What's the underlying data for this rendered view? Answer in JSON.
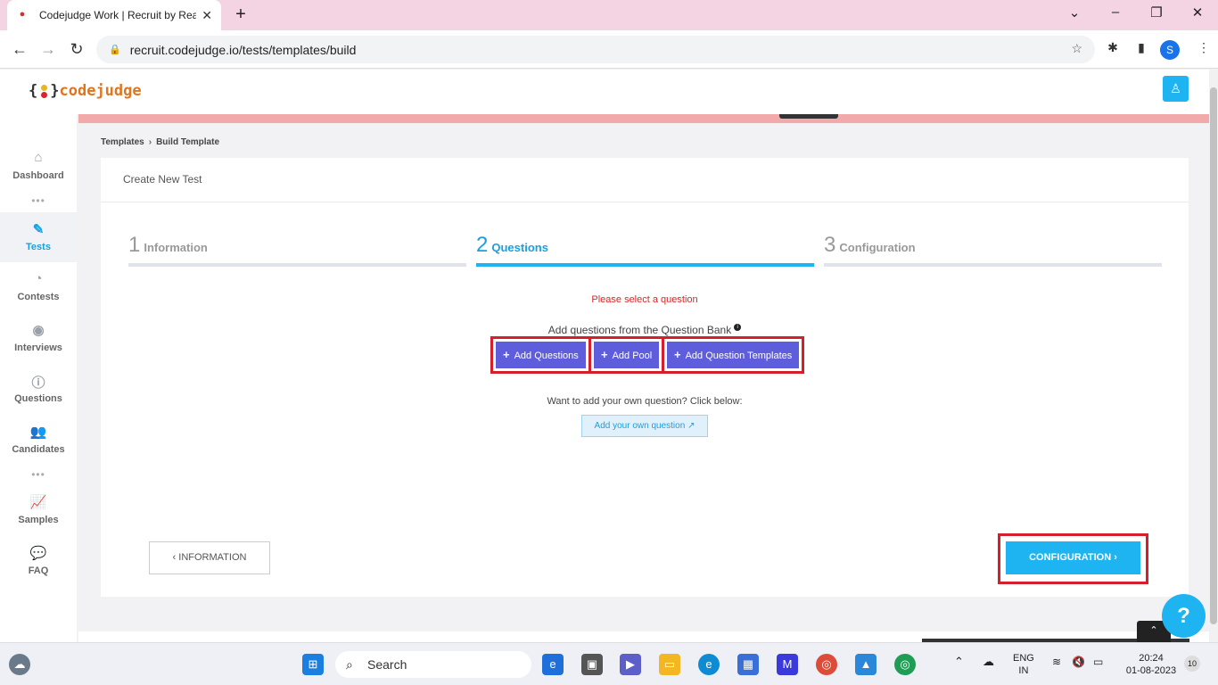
{
  "browser": {
    "tab_title": "Codejudge Work | Recruit by Rea",
    "tab_close": "✕",
    "new_tab": "+",
    "url": "recruit.codejudge.io/tests/templates/build",
    "profile_initial": "S"
  },
  "logo": {
    "text": "codejudge"
  },
  "sidebar": {
    "items": [
      {
        "label": "Dashboard",
        "icon": "home-icon"
      },
      {
        "label": "Tests",
        "icon": "pen-icon"
      },
      {
        "label": "Contests",
        "icon": "pie-chart-icon"
      },
      {
        "label": "Interviews",
        "icon": "podcast-icon"
      },
      {
        "label": "Questions",
        "icon": "question-circle-icon"
      },
      {
        "label": "Candidates",
        "icon": "users-icon"
      },
      {
        "label": "Samples",
        "icon": "chart-line-icon"
      },
      {
        "label": "FAQ",
        "icon": "comments-icon"
      }
    ]
  },
  "breadcrumb": {
    "root": "Templates",
    "sep": "›",
    "current": "Build Template"
  },
  "card": {
    "title": "Create New Test"
  },
  "steps": [
    {
      "num": "1",
      "label": "Information"
    },
    {
      "num": "2",
      "label": "Questions"
    },
    {
      "num": "3",
      "label": "Configuration"
    }
  ],
  "messages": {
    "error": "Please select a question",
    "question_bank": "Add questions from the Question Bank",
    "own_question": "Want to add your own question? Click below:"
  },
  "buttons": {
    "add_questions": "Add Questions",
    "add_pool": "Add Pool",
    "add_templates": "Add Question Templates",
    "add_own": "Add your own question",
    "back": "‹ INFORMATION",
    "next": "CONFIGURATION ›",
    "help": "?"
  },
  "taskbar": {
    "search": "Search",
    "lang_top": "ENG",
    "lang_bottom": "IN",
    "time": "20:24",
    "date": "01-08-2023",
    "notif_count": "10"
  }
}
